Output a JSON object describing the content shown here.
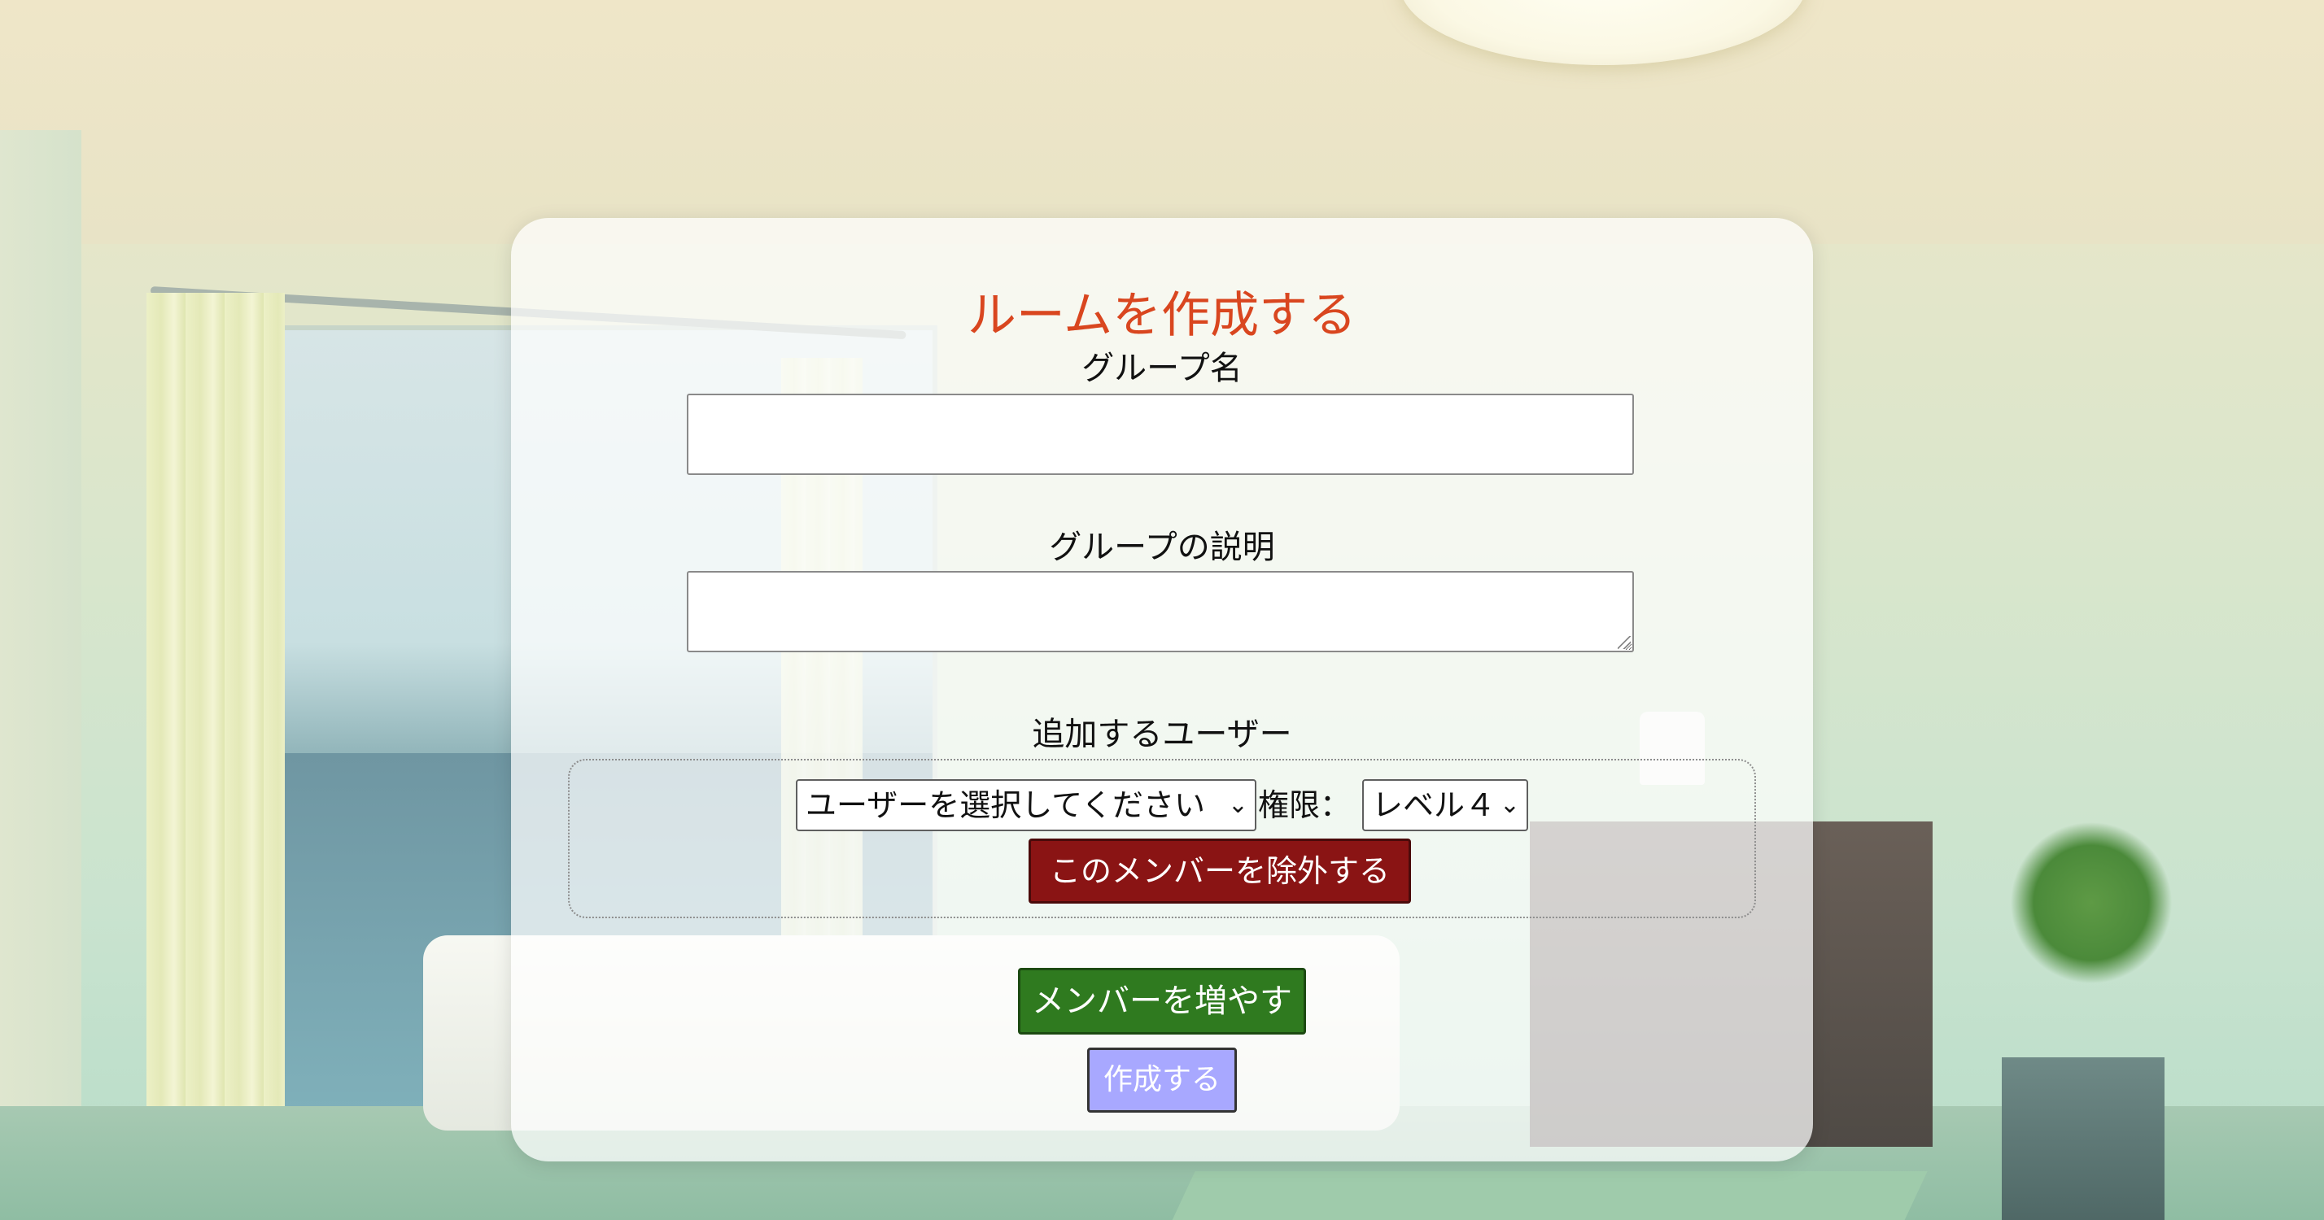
{
  "form": {
    "title": "ルームを作成する",
    "group_name": {
      "label": "グループ名",
      "value": ""
    },
    "group_description": {
      "label": "グループの説明",
      "value": ""
    },
    "users_section": {
      "label": "追加するユーザー",
      "members": [
        {
          "user_select_value": "ユーザーを選択してください",
          "permission_label": "権限：",
          "permission_value": "レベル４",
          "remove_button_label": "このメンバーを除外する"
        }
      ]
    },
    "add_member_button_label": "メンバーを増やす",
    "create_button_label": "作成する"
  },
  "colors": {
    "title": "#d9461f",
    "remove_button_bg": "#8a1414",
    "add_button_bg": "#2f7a1f",
    "create_button_bg": "#a8a8ff"
  },
  "icons": {
    "select_arrow": "chevron-down-icon"
  }
}
